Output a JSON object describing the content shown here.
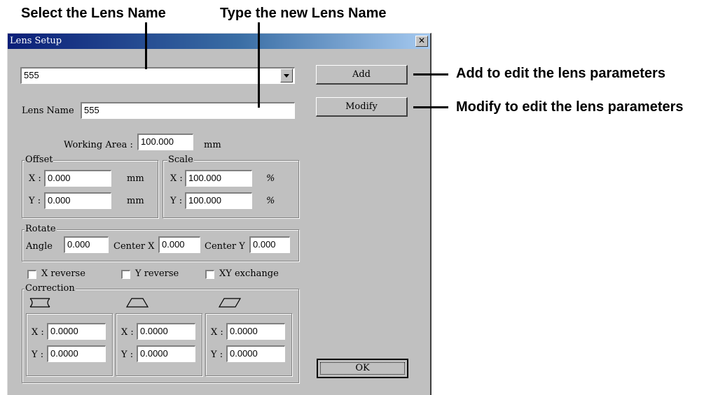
{
  "callouts": {
    "select_lens": "Select the Lens Name",
    "type_lens": "Type the new Lens Name",
    "add_note": "Add to edit the lens parameters",
    "modify_note": "Modify to edit the lens parameters"
  },
  "dialog": {
    "title": "Lens Setup",
    "close_glyph": "✕",
    "lens_select_value": "555",
    "lens_name_label": "Lens Name",
    "lens_name_value": "555",
    "add_label": "Add",
    "modify_label": "Modify",
    "working_area_label": "Working Area :",
    "working_area_value": "100.000",
    "working_area_unit": "mm",
    "offset": {
      "title": "Offset",
      "x_label": "X :",
      "x_value": "0.000",
      "y_label": "Y :",
      "y_value": "0.000",
      "unit": "mm"
    },
    "scale": {
      "title": "Scale",
      "x_label": "X :",
      "x_value": "100.000",
      "y_label": "Y :",
      "y_value": "100.000",
      "unit": "%"
    },
    "rotate": {
      "title": "Rotate",
      "angle_label": "Angle",
      "angle_value": "0.000",
      "cx_label": "Center X",
      "cx_value": "0.000",
      "cy_label": "Center Y",
      "cy_value": "0.000"
    },
    "checkboxes": {
      "x_reverse": "X reverse",
      "y_reverse": "Y reverse",
      "xy_exchange": "XY exchange"
    },
    "correction": {
      "title": "Correction",
      "x_label": "X :",
      "y_label": "Y :",
      "groups": [
        {
          "icon": "pincushion-icon",
          "x": "0.0000",
          "y": "0.0000"
        },
        {
          "icon": "trapezoid-icon",
          "x": "0.0000",
          "y": "0.0000"
        },
        {
          "icon": "parallelogram-icon",
          "x": "0.0000",
          "y": "0.0000"
        }
      ]
    },
    "ok_label": "OK"
  }
}
